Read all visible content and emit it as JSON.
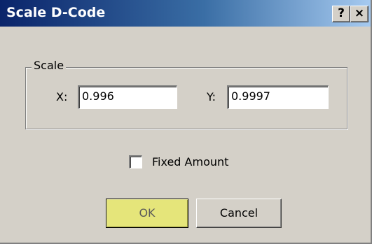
{
  "window": {
    "title": "Scale D-Code",
    "help_label": "?",
    "close_label": "×"
  },
  "scale_group": {
    "label": "Scale",
    "x_label": "X:",
    "x_value": "0.996",
    "y_label": "Y:",
    "y_value": "0.9997"
  },
  "fixed_amount": {
    "label": "Fixed Amount",
    "checked": false
  },
  "buttons": {
    "ok_label": "OK",
    "cancel_label": "Cancel"
  },
  "colors": {
    "titlebar_start": "#0a246a",
    "titlebar_end": "#a6caf0",
    "dialog_face": "#d4d0c8",
    "ok_highlight": "#e5e57a"
  }
}
